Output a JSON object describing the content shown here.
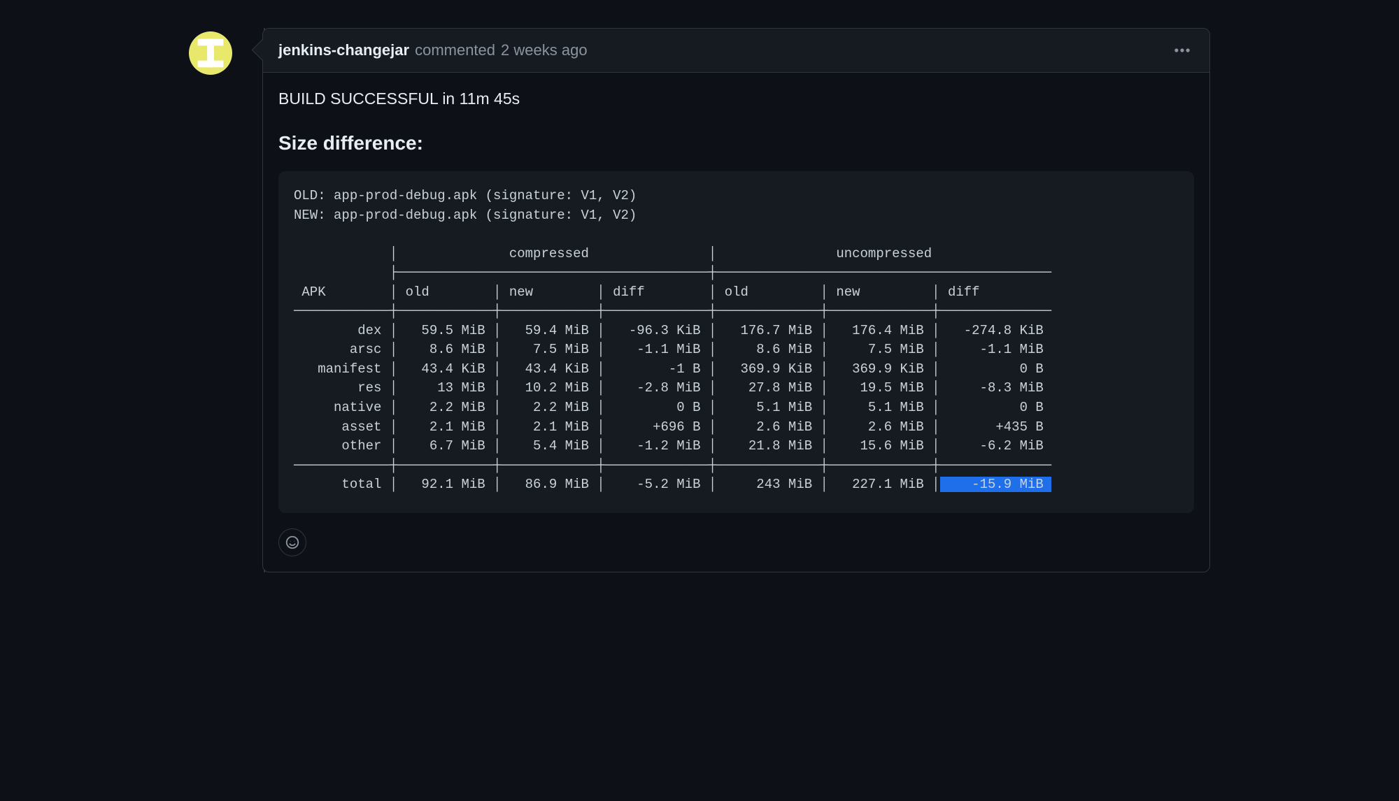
{
  "comment": {
    "author": "jenkins-changejar",
    "verb": "commented",
    "timestamp": "2 weeks ago",
    "body": {
      "build_line": "BUILD SUCCESSFUL in 11m 45s",
      "heading": "Size difference:",
      "code": {
        "old_line": "OLD: app-prod-debug.apk (signature: V1, V2)",
        "new_line": "NEW: app-prod-debug.apk (signature: V1, V2)",
        "col_groups": [
          "compressed",
          "uncompressed"
        ],
        "col_headers": [
          "APK",
          "old",
          "new",
          "diff",
          "old",
          "new",
          "diff"
        ],
        "table_rows": [
          [
            "dex",
            "59.5 MiB",
            "59.4 MiB",
            "-96.3 KiB",
            "176.7 MiB",
            "176.4 MiB",
            "-274.8 KiB"
          ],
          [
            "arsc",
            "8.6 MiB",
            "7.5 MiB",
            "-1.1 MiB",
            "8.6 MiB",
            "7.5 MiB",
            "-1.1 MiB"
          ],
          [
            "manifest",
            "43.4 KiB",
            "43.4 KiB",
            "-1 B",
            "369.9 KiB",
            "369.9 KiB",
            "0 B"
          ],
          [
            "res",
            "13 MiB",
            "10.2 MiB",
            "-2.8 MiB",
            "27.8 MiB",
            "19.5 MiB",
            "-8.3 MiB"
          ],
          [
            "native",
            "2.2 MiB",
            "2.2 MiB",
            "0 B",
            "5.1 MiB",
            "5.1 MiB",
            "0 B"
          ],
          [
            "asset",
            "2.1 MiB",
            "2.1 MiB",
            "+696 B",
            "2.6 MiB",
            "2.6 MiB",
            "+435 B"
          ],
          [
            "other",
            "6.7 MiB",
            "5.4 MiB",
            "-1.2 MiB",
            "21.8 MiB",
            "15.6 MiB",
            "-6.2 MiB"
          ]
        ],
        "total_row": [
          "total",
          "92.1 MiB",
          "86.9 MiB",
          "-5.2 MiB",
          "243 MiB",
          "227.1 MiB",
          "-15.9 MiB"
        ],
        "highlight_total_last": true
      }
    }
  }
}
